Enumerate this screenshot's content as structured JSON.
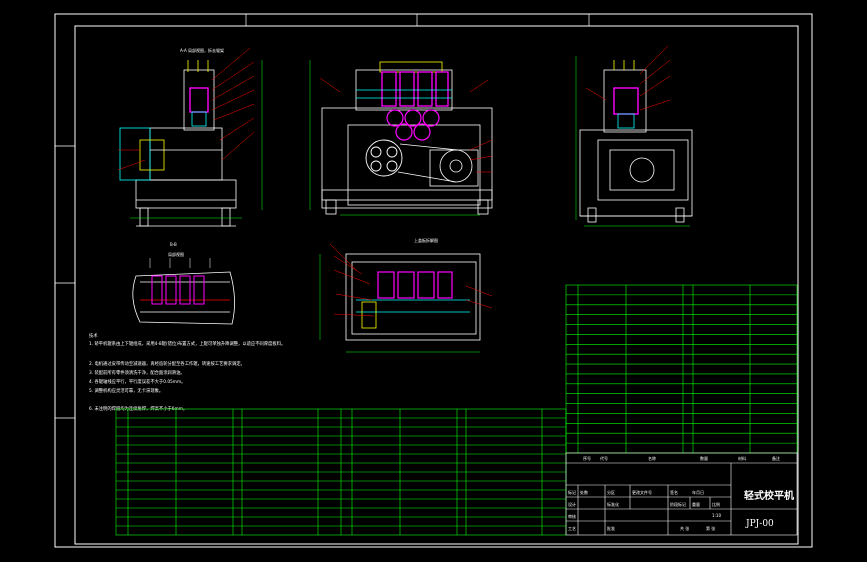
{
  "drawing": {
    "title": "轻式校平机",
    "code": "JPJ-00"
  },
  "sheet_labels": {
    "top_view": "上盖板拆解图",
    "section_view": "B-B",
    "section_detail": "局部视图",
    "scale": "1:10"
  },
  "notes": {
    "heading": "技术",
    "lines": [
      "1. 矫平机辊系由上下辊组成，采用4-8辊(错位)布置方式，上辊可单独升降调整，以适应不同厚度板料。",
      "2. 电机通过皮带传动至减速器，再经齿轮分配至各工作辊，转速按工艺要求调定。",
      "3. 装配前所有零件须清洗干净，配合面涂润滑油。",
      "4. 各辊轴线应平行，平行度误差不大于0.05mm。",
      "5. 调整机构应灵活可靠，无卡滞现象。",
      "6. 未注明的焊缝均为连续角焊，焊高不小于6mm。"
    ]
  },
  "title_block": {
    "head_labels": [
      "序号",
      "代号",
      "名称",
      "数量",
      "材料",
      "备注"
    ],
    "row1": [
      "标记",
      "处数",
      "分区",
      "更改文件号",
      "签名",
      "年月日"
    ],
    "row2": [
      "设计",
      "",
      "标准化",
      "",
      "阶段标记",
      "重量",
      "比例"
    ],
    "row3": [
      "审核",
      "",
      "",
      "",
      "共 张",
      "第 张"
    ],
    "row4": [
      "工艺",
      "",
      "批准",
      ""
    ]
  },
  "colors": {
    "frame": "#ffffff",
    "table": "#00ff00",
    "part": "#ffffff",
    "accent_magenta": "#ff00ff",
    "accent_red": "#ff0000",
    "accent_cyan": "#00ffff",
    "accent_yellow": "#ffff00",
    "accent_green": "#00ff00"
  }
}
